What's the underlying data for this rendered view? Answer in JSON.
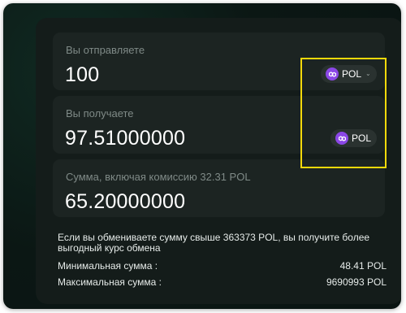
{
  "send": {
    "label": "Вы отправляете",
    "value": "100",
    "token": "POL"
  },
  "receive": {
    "label": "Вы получаете",
    "value": "97.51000000",
    "token": "POL"
  },
  "sum": {
    "label": "Сумма, включая комиссию 32.31 POL",
    "value": "65.20000000"
  },
  "note": "Если вы обмениваете сумму свыше 363373 POL, вы получите более выгодный курс обмена",
  "limits": {
    "min_label": "Минимальная сумма :",
    "min_value": "48.41 POL",
    "max_label": "Максимальная сумма :",
    "max_value": "9690993 POL"
  },
  "icons": {
    "token": "polygon-icon",
    "dropdown": "chevron-down-icon"
  },
  "colors": {
    "accent": "#8b47e6",
    "highlight": "#f5d90a"
  }
}
